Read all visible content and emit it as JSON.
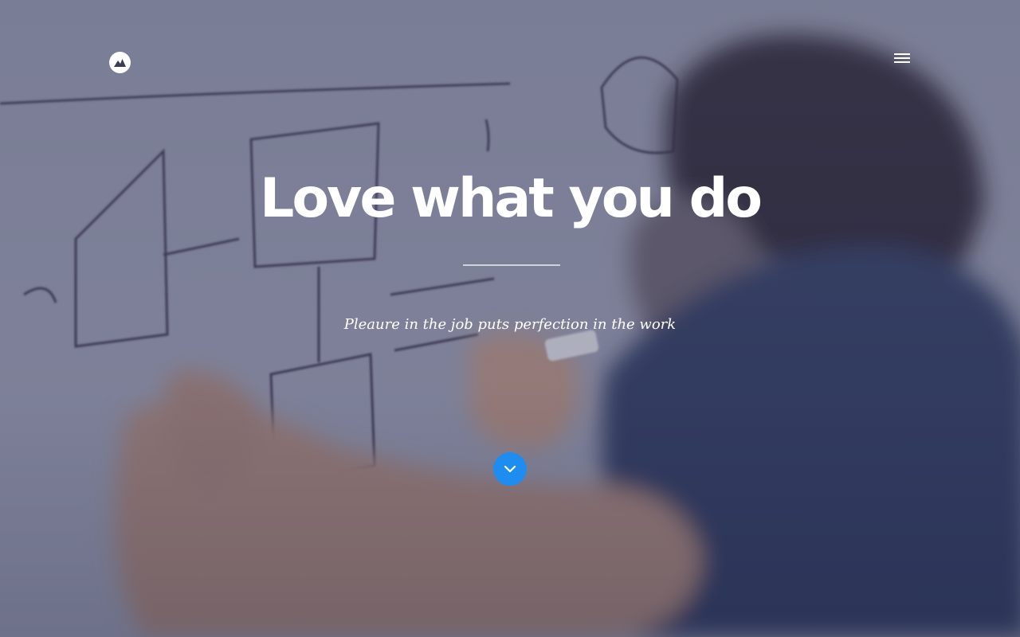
{
  "hero": {
    "headline": "Love what you do",
    "tagline": "Pleaure in the job puts perfection in the work",
    "background": "photo-person-writing-on-whiteboard"
  },
  "header": {
    "logo_icon": "mountain-logo-icon",
    "menu_icon": "hamburger-menu-icon"
  },
  "scroll_button": {
    "icon": "chevron-down-icon"
  },
  "colors": {
    "accent": "#1f8cf0",
    "overlay": "#4a4e68",
    "text": "#ffffff"
  }
}
